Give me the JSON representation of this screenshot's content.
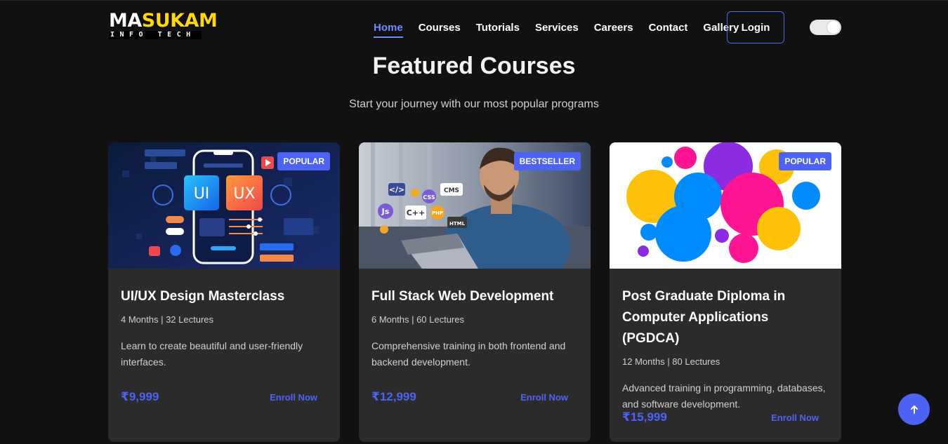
{
  "brand": {
    "logo_main_a": "MA",
    "logo_main_b": "SUKAM",
    "logo_sub": "INFO TECH"
  },
  "nav": {
    "items": [
      {
        "label": "Home",
        "active": true
      },
      {
        "label": "Courses"
      },
      {
        "label": "Tutorials"
      },
      {
        "label": "Services"
      },
      {
        "label": "Careers"
      },
      {
        "label": "Contact"
      },
      {
        "label": "Gallery"
      }
    ],
    "login_label": "Login"
  },
  "section": {
    "title": "Featured Courses",
    "subtitle": "Start your journey with our most popular programs"
  },
  "courses": [
    {
      "badge": "POPULAR",
      "title": "UI/UX Design Masterclass",
      "meta": "4 Months | 32 Lectures",
      "desc": "Learn to create beautiful and user-friendly interfaces.",
      "price": "₹9,999",
      "cta": "Enroll Now",
      "image_text": {
        "ui": "UI",
        "ux": "UX"
      }
    },
    {
      "badge": "BESTSELLER",
      "title": "Full Stack Web Development",
      "meta": "6 Months | 60 Lectures",
      "desc": "Comprehensive training in both frontend and backend development.",
      "price": "₹12,999",
      "cta": "Enroll Now",
      "image_text": {
        "code": "</>",
        "cms": "CMS",
        "css": "CSS",
        "js": "Js",
        "cpp": "C++",
        "php": "PHP",
        "html": "HTML"
      }
    },
    {
      "badge": "POPULAR",
      "title": "Post Graduate Diploma in Computer Applications (PGDCA)",
      "meta": "12 Months | 80 Lectures",
      "desc": "Advanced training in programming, databases, and software development.",
      "price": "₹15,999",
      "cta": "Enroll Now"
    }
  ],
  "colors": {
    "accent": "#4d63f5",
    "background": "#111111",
    "card": "#2b2b2b",
    "logo_highlight": "#ffd800"
  },
  "icons": {
    "scroll_top": "arrow-up-icon",
    "theme_toggle": "toggle-switch"
  }
}
